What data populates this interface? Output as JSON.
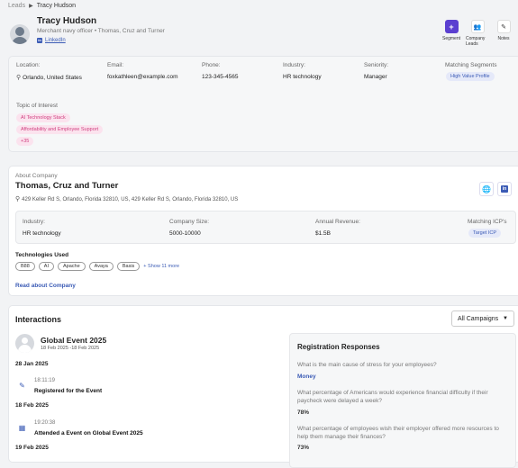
{
  "breadcrumb": {
    "root": "Leads",
    "current": "Tracy Hudson"
  },
  "profile": {
    "name": "Tracy Hudson",
    "title": "Merchant navy officer • Thomas, Cruz and Turner",
    "linkedin": "LinkedIn"
  },
  "tools": [
    {
      "label": "Segment",
      "icon": "plus-icon"
    },
    {
      "label": "Company Leads",
      "icon": "people-icon"
    },
    {
      "label": "Notes",
      "icon": "note-icon"
    }
  ],
  "details": {
    "location_label": "Location:",
    "location": "Orlando, United States",
    "email_label": "Email:",
    "email": "foxkathleen@example.com",
    "phone_label": "Phone:",
    "phone": "123-345-4565",
    "industry_label": "Industry:",
    "industry": "HR technology",
    "seniority_label": "Seniority:",
    "seniority": "Manager",
    "segments_label": "Matching Segments",
    "segment": "High Value Profile",
    "topic_label": "Topic of Interest",
    "topics": [
      "AI Technology Stack",
      "Affordability and Employee Support",
      "+35"
    ]
  },
  "company": {
    "about_label": "About Company",
    "name": "Thomas, Cruz and Turner",
    "address": "429 Keller Rd S, Orlando, Florida 32810, US, 429 Keller Rd S, Orlando, Florida 32810, US",
    "industry_label": "Industry:",
    "industry": "HR technology",
    "size_label": "Company Size:",
    "size": "5000-10000",
    "revenue_label": "Annual Revenue:",
    "revenue": "$1.5B",
    "icp_label": "Matching ICP's",
    "icp": "Target ICP",
    "tech_label": "Technologies Used",
    "techs": [
      "B88",
      "AI",
      "Apache",
      "Avaya",
      "Basis"
    ],
    "tech_more": "+ Show 11 more",
    "read_link": "Read about Company"
  },
  "interactions": {
    "title": "Interactions",
    "filter": "All Campaigns",
    "event_name": "Global Event 2025",
    "event_dates": "18 Feb 2025 -18 Feb 2025",
    "timeline": [
      {
        "date": "28 Jan 2025",
        "time": "18:11:19",
        "event": "Registered for the Event",
        "icon": "edit-icon"
      },
      {
        "date": "18 Feb 2025",
        "time": "19:20:38",
        "event": "Attended a Event on Global Event 2025",
        "icon": "calendar-icon"
      },
      {
        "date": "19 Feb 2025"
      }
    ],
    "responses_title": "Registration Responses",
    "responses": [
      {
        "q": "What is the main cause of stress for your employees?",
        "a": "Money"
      },
      {
        "q": "What percentage of Americans would experience financial difficulty if their paycheck were delayed a week?",
        "a": "78%"
      },
      {
        "q": "What percentage of employees wish their employer offered more resources to help them manage their finances?",
        "a": "73%"
      }
    ]
  },
  "colors": {
    "accent": "#5b3fd0",
    "link": "#3b5bb5",
    "pink": "#d04080"
  }
}
